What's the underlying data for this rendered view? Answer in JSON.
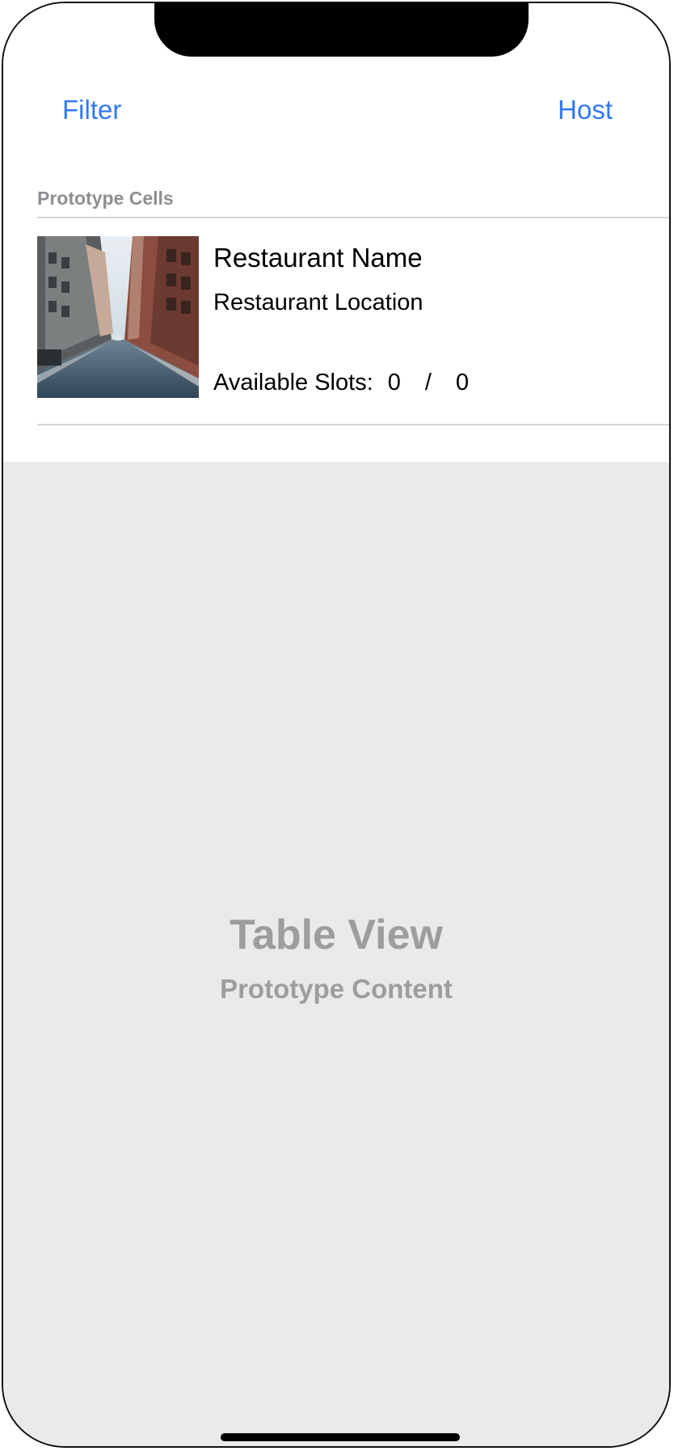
{
  "navbar": {
    "left_button": "Filter",
    "right_button": "Host"
  },
  "table": {
    "section_header": "Prototype Cells",
    "cell": {
      "title": "Restaurant Name",
      "subtitle": "Restaurant Location",
      "slots_label": "Available Slots:",
      "slots_current": "0",
      "slots_separator": "/",
      "slots_total": "0",
      "image_icon": "street-photo"
    }
  },
  "placeholder": {
    "title": "Table View",
    "subtitle": "Prototype Content"
  },
  "colors": {
    "accent": "#3478f6",
    "placeholder_bg": "#eaeaea",
    "placeholder_text": "#9d9d9d",
    "section_header_text": "#8e8e93"
  }
}
